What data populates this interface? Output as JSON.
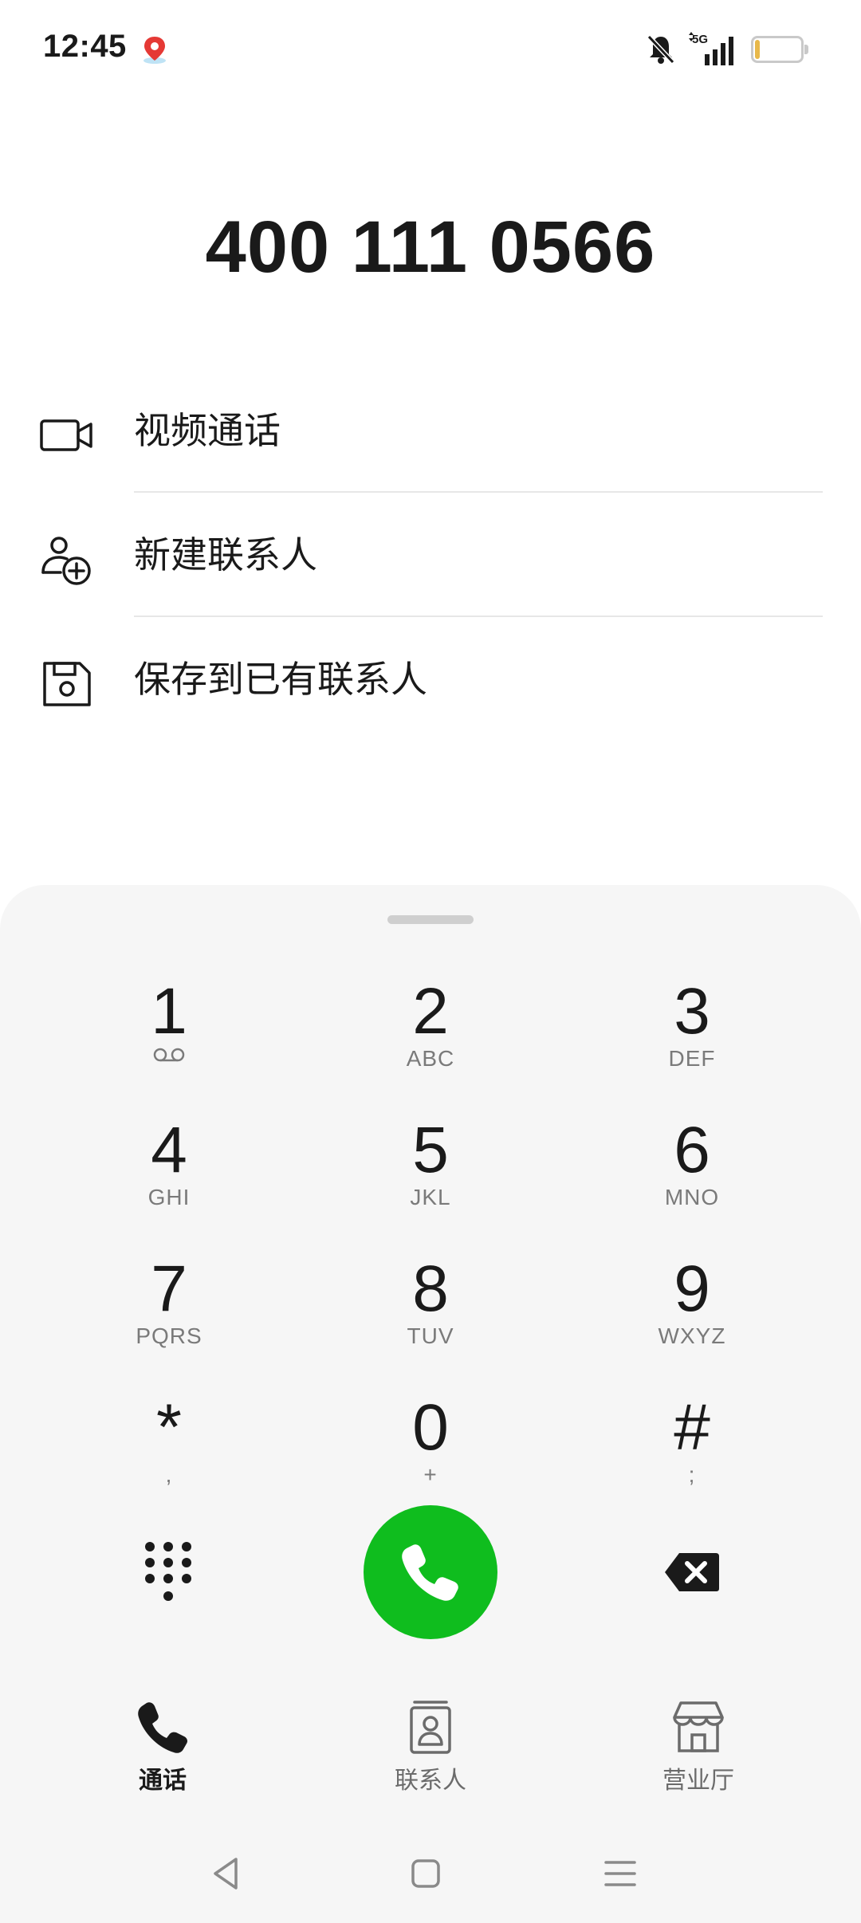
{
  "status_bar": {
    "time": "12:45",
    "network": "5G",
    "battery_level": "6",
    "battery_fraction": 0.06,
    "icons": [
      "map-pin-icon",
      "bell-muted-icon",
      "signal-5g-icon",
      "battery-icon"
    ]
  },
  "dialed_number": "400 111 0566",
  "actions": [
    {
      "label": "视频通话",
      "icon": "video-camera-icon"
    },
    {
      "label": "新建联系人",
      "icon": "add-person-icon"
    },
    {
      "label": "保存到已有联系人",
      "icon": "save-disk-icon"
    }
  ],
  "dialpad": {
    "keys": [
      {
        "digit": "1",
        "letters": "",
        "icon": "voicemail-icon"
      },
      {
        "digit": "2",
        "letters": "ABC"
      },
      {
        "digit": "3",
        "letters": "DEF"
      },
      {
        "digit": "4",
        "letters": "GHI"
      },
      {
        "digit": "5",
        "letters": "JKL"
      },
      {
        "digit": "6",
        "letters": "MNO"
      },
      {
        "digit": "7",
        "letters": "PQRS"
      },
      {
        "digit": "8",
        "letters": "TUV"
      },
      {
        "digit": "9",
        "letters": "WXYZ"
      },
      {
        "digit": "*",
        "letters": ","
      },
      {
        "digit": "0",
        "letters": "+"
      },
      {
        "digit": "#",
        "letters": ";"
      }
    ],
    "call_color": "#0fbd1e"
  },
  "tabs": [
    {
      "label": "通话",
      "icon": "phone-icon",
      "active": true
    },
    {
      "label": "联系人",
      "icon": "contacts-icon",
      "active": false
    },
    {
      "label": "营业厅",
      "icon": "store-icon",
      "active": false
    }
  ],
  "nav": [
    "back-icon",
    "home-icon",
    "recents-icon"
  ]
}
